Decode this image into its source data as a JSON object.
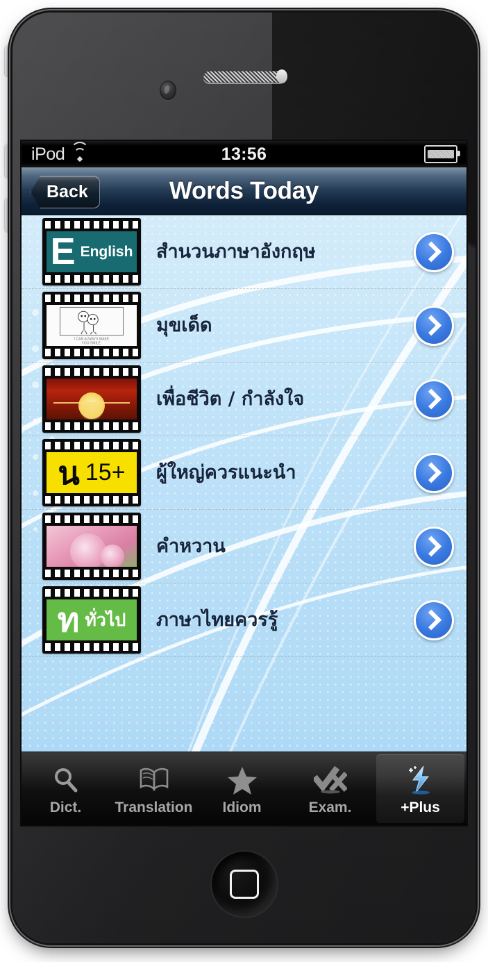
{
  "device": {
    "type": "ipod-touch",
    "hardware": {
      "power_button": "power-button",
      "mute_switch": "mute-switch",
      "volume_up": "volume-up-button",
      "volume_down": "volume-down-button",
      "home_button": "home-button",
      "camera": "front-camera",
      "earpiece": "earpiece-speaker"
    }
  },
  "status_bar": {
    "carrier": "iPod",
    "wifi_icon": "wifi-icon",
    "time": "13:56",
    "battery_icon": "battery-full-icon"
  },
  "nav_bar": {
    "back_label": "Back",
    "title": "Words Today"
  },
  "list": {
    "rows": [
      {
        "title": "สำนวนภาษาอังกฤษ",
        "thumb_kind": "english",
        "thumb_big": "E",
        "thumb_label": "English",
        "thumb_color": "#186b70",
        "chevron_icon": "chevron-right-icon"
      },
      {
        "title": "มุขเด็ด",
        "thumb_kind": "sketch",
        "thumb_caption": "I CAN ALWAYS MAKE YOU SMILE.",
        "thumb_color": "#fbfbfb",
        "chevron_icon": "chevron-right-icon"
      },
      {
        "title": "เพื่อชีวิต / กำลังใจ",
        "thumb_kind": "sunset",
        "thumb_color": "#b5240c",
        "chevron_icon": "chevron-right-icon"
      },
      {
        "title": "ผู้ใหญ่ควรแนะนำ",
        "thumb_kind": "rating",
        "thumb_big": "น",
        "thumb_label": "15+",
        "thumb_color": "#f7e000",
        "chevron_icon": "chevron-right-icon"
      },
      {
        "title": "คำหวาน",
        "thumb_kind": "rose",
        "thumb_color": "#e79ab8",
        "chevron_icon": "chevron-right-icon"
      },
      {
        "title": "ภาษาไทยควรรู้",
        "thumb_kind": "thai",
        "thumb_big": "ท",
        "thumb_label": "ทั่วไป",
        "thumb_color": "#64bb46",
        "chevron_icon": "chevron-right-icon"
      }
    ]
  },
  "tab_bar": {
    "tabs": [
      {
        "label": "Dict.",
        "icon": "magnifier-icon",
        "selected": false
      },
      {
        "label": "Translation",
        "icon": "open-book-icon",
        "selected": false
      },
      {
        "label": "Idiom",
        "icon": "star-icon",
        "selected": false
      },
      {
        "label": "Exam.",
        "icon": "check-x-icon",
        "selected": false
      },
      {
        "label": "+Plus",
        "icon": "lightning-bolt-icon",
        "selected": true
      }
    ]
  },
  "colors": {
    "nav_bar_dark": "#0e2138",
    "content_blue": "#bfe2f8",
    "chevron_blue": "#3a7ae0",
    "tab_text": "#a7a7a7",
    "tab_selected_text": "#ffffff",
    "row_title": "#15253d"
  }
}
